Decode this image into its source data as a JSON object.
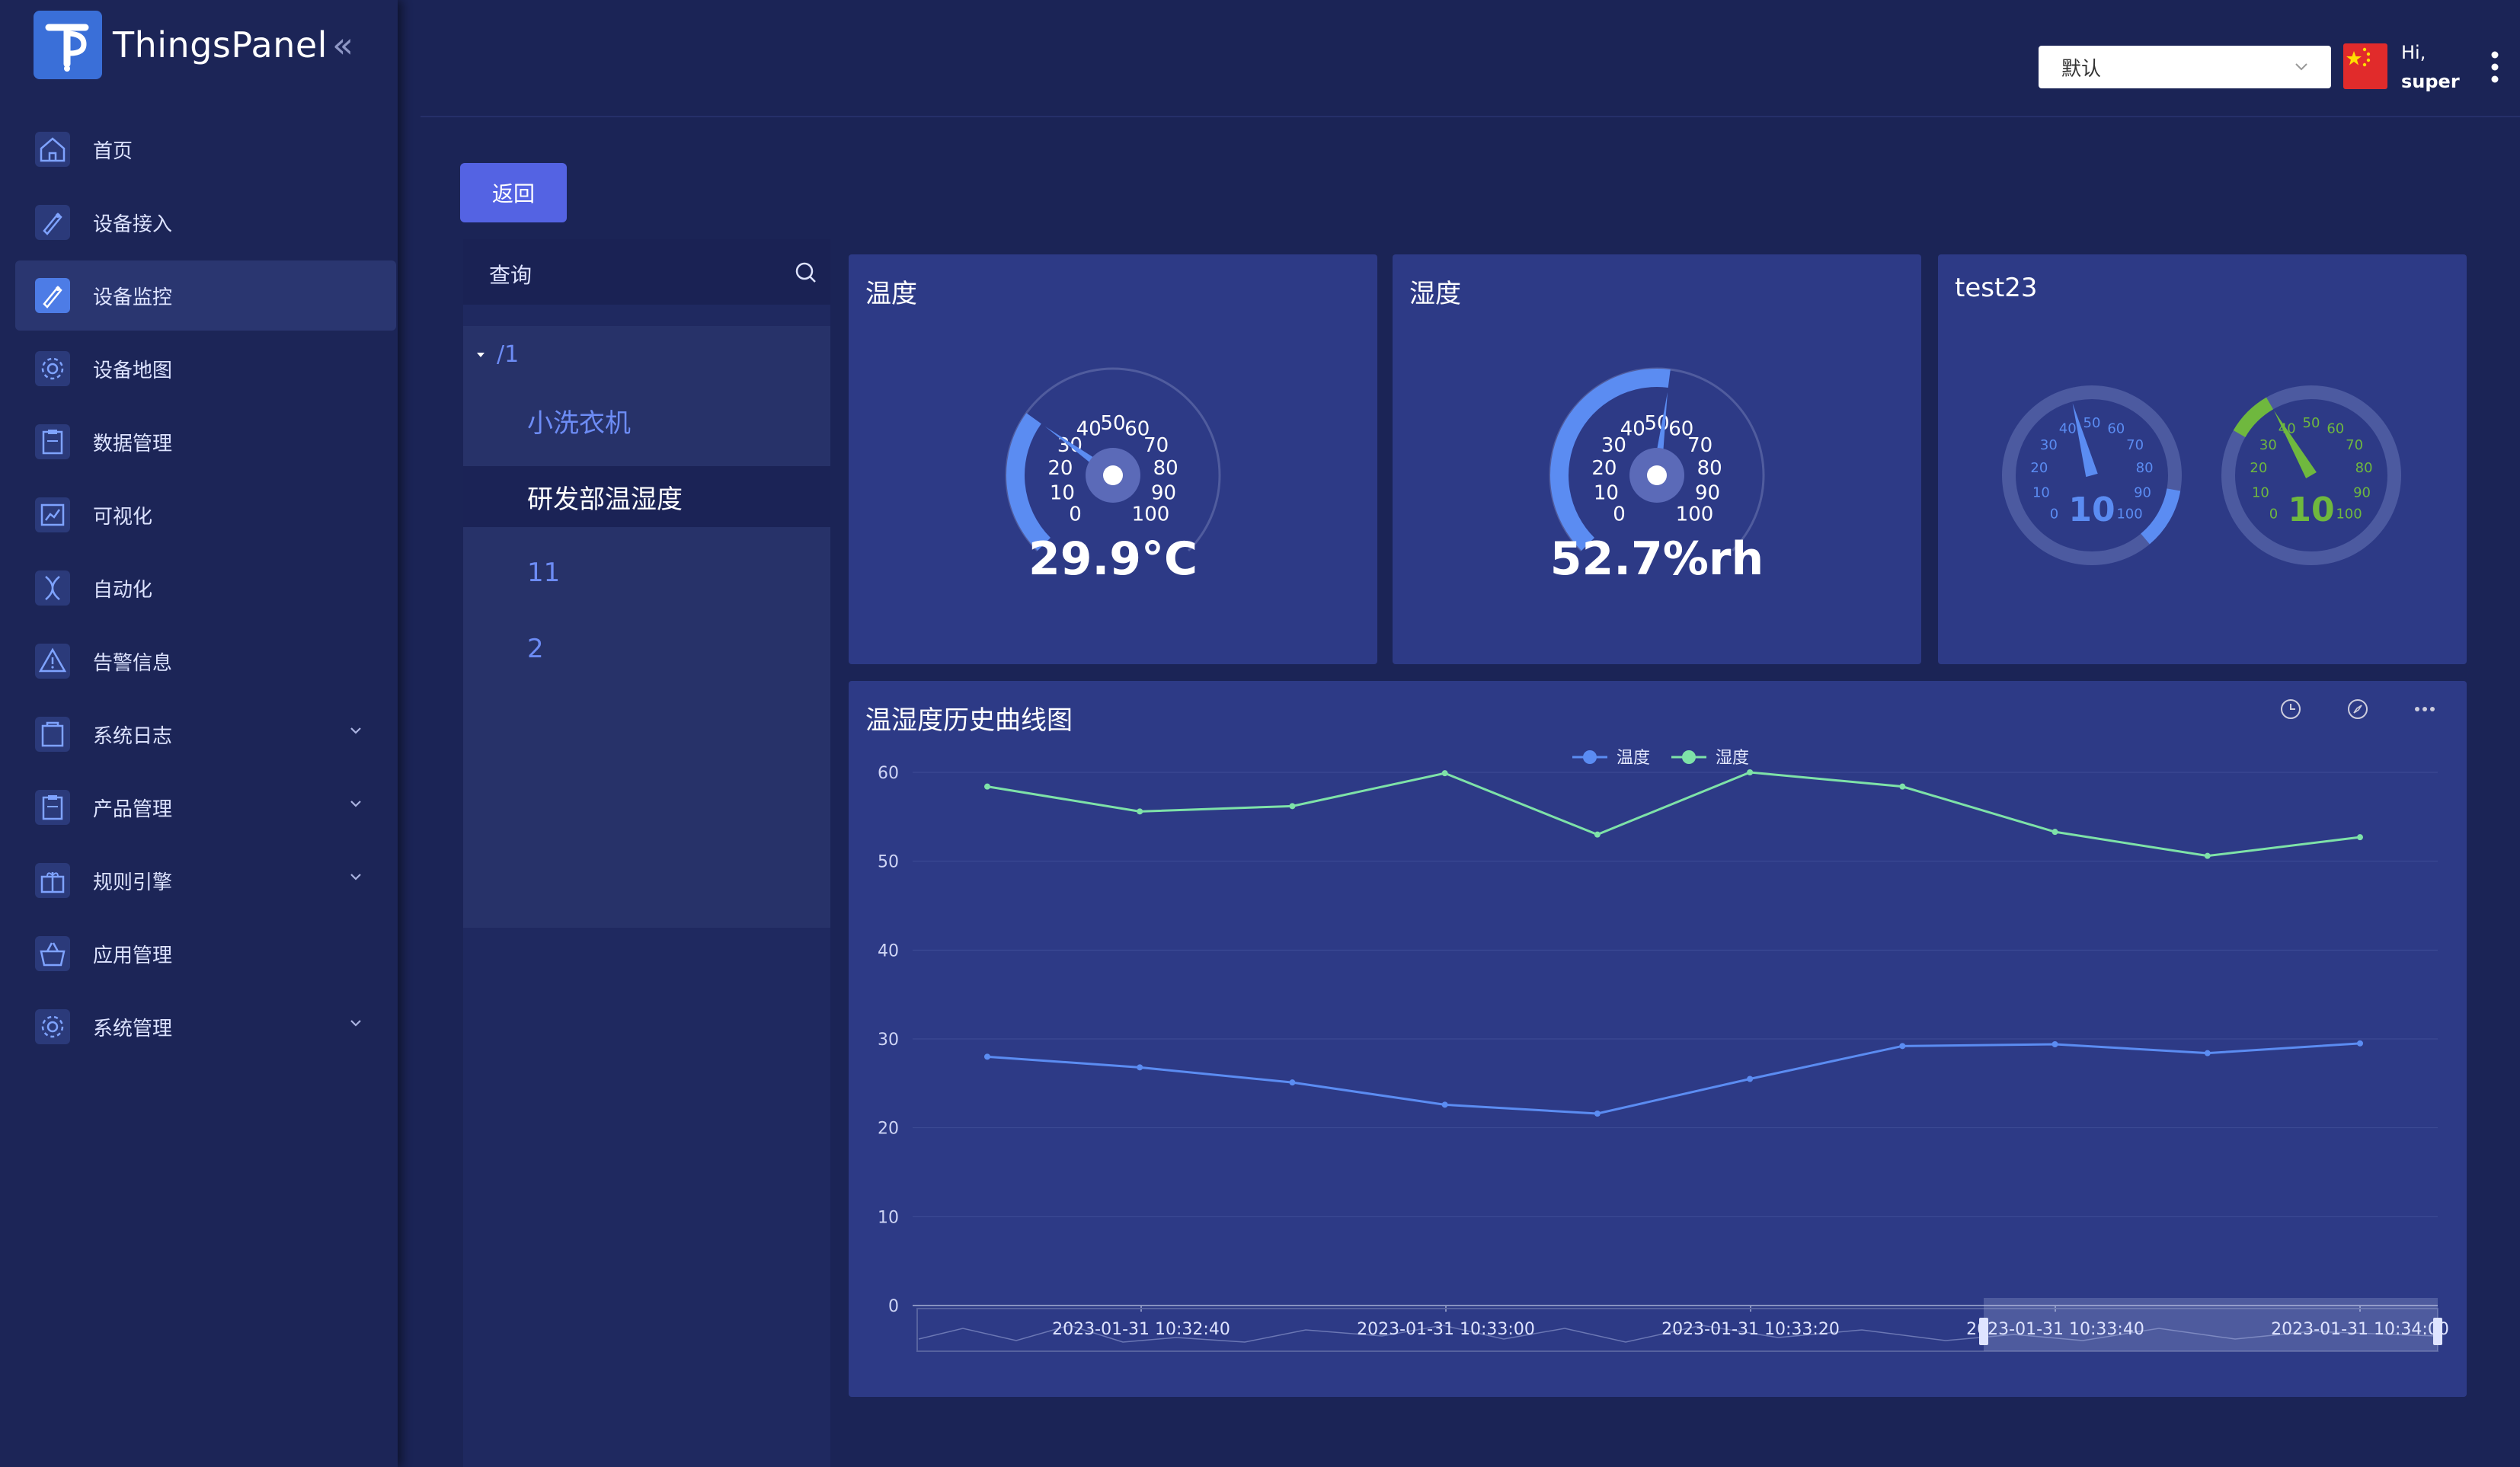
{
  "app": {
    "name": "ThingsPanel"
  },
  "sidebar": {
    "items": [
      {
        "label": "首页",
        "icon": "home-icon",
        "expandable": false,
        "active": false
      },
      {
        "label": "设备接入",
        "icon": "device-access-icon",
        "expandable": false,
        "active": false
      },
      {
        "label": "设备监控",
        "icon": "device-monitor-icon",
        "expandable": false,
        "active": true
      },
      {
        "label": "设备地图",
        "icon": "gear-icon",
        "expandable": false,
        "active": false
      },
      {
        "label": "数据管理",
        "icon": "clipboard-icon",
        "expandable": false,
        "active": false
      },
      {
        "label": "可视化",
        "icon": "chart-icon",
        "expandable": false,
        "active": false
      },
      {
        "label": "自动化",
        "icon": "dna-icon",
        "expandable": false,
        "active": false
      },
      {
        "label": "告警信息",
        "icon": "warning-icon",
        "expandable": false,
        "active": false
      },
      {
        "label": "系统日志",
        "icon": "log-icon",
        "expandable": true,
        "active": false
      },
      {
        "label": "产品管理",
        "icon": "clipboard-icon",
        "expandable": true,
        "active": false
      },
      {
        "label": "规则引擎",
        "icon": "gift-icon",
        "expandable": true,
        "active": false
      },
      {
        "label": "应用管理",
        "icon": "basket-icon",
        "expandable": false,
        "active": false
      },
      {
        "label": "系统管理",
        "icon": "gear-icon",
        "expandable": true,
        "active": false
      }
    ]
  },
  "header": {
    "dashboard_select": "默认",
    "greeting": "Hi,",
    "username": "super"
  },
  "back_button": "返回",
  "tree": {
    "search_placeholder": "查询",
    "root": "/1",
    "items": [
      {
        "label": "小洗衣机",
        "selected": false
      },
      {
        "label": "研发部温湿度",
        "selected": true
      },
      {
        "label": "11",
        "selected": false
      },
      {
        "label": "2",
        "selected": false
      }
    ]
  },
  "cards": {
    "temperature": {
      "title": "温度",
      "value_text": "29.9°C",
      "value": 29.9,
      "max": 100,
      "ticks": [
        "0",
        "10",
        "20",
        "30",
        "40",
        "50",
        "60",
        "70",
        "80",
        "90",
        "100"
      ]
    },
    "humidity": {
      "title": "湿度",
      "value_text": "52.7%rh",
      "value": 52.7,
      "max": 100,
      "ticks": [
        "0",
        "10",
        "20",
        "30",
        "40",
        "50",
        "60",
        "70",
        "80",
        "90",
        "100"
      ]
    },
    "test23": {
      "title": "test23",
      "left_gauge": {
        "value_text": "10",
        "ticks": [
          "0",
          "10",
          "20",
          "30",
          "40",
          "50",
          "60",
          "70",
          "80",
          "90",
          "100"
        ]
      },
      "right_gauge": {
        "value_text": "10",
        "ticks": [
          "0",
          "10",
          "20",
          "30",
          "40",
          "50",
          "60",
          "70",
          "80",
          "90",
          "100"
        ]
      }
    }
  },
  "chart_data": {
    "type": "line",
    "title": "温湿度历史曲线图",
    "legend": [
      "温度",
      "湿度"
    ],
    "legend_position": "top-center",
    "ylim": [
      0,
      60
    ],
    "yticks": [
      0,
      10,
      20,
      30,
      40,
      50,
      60
    ],
    "x_labels": [
      "2023-01-31 10:32:40",
      "2023-01-31 10:33:00",
      "2023-01-31 10:33:20",
      "2023-01-31 10:33:40",
      "2023-01-31 10:34:00"
    ],
    "series": [
      {
        "name": "温度",
        "color": "#5b8cf2",
        "values": [
          28.0,
          26.8,
          25.1,
          22.6,
          21.6,
          25.5,
          29.2,
          29.4,
          28.4,
          29.5
        ]
      },
      {
        "name": "湿度",
        "color": "#7ee2a8",
        "values": [
          58.4,
          55.6,
          56.2,
          59.9,
          53.0,
          60.0,
          58.4,
          53.3,
          50.6,
          52.7
        ]
      }
    ],
    "grid": true,
    "datazoom": true
  },
  "colors": {
    "accent": "#5463e3",
    "sidebar": "#1c2557",
    "card": "#2d3a86",
    "temp": "#5b8cf2",
    "humi": "#7ee2a8"
  }
}
